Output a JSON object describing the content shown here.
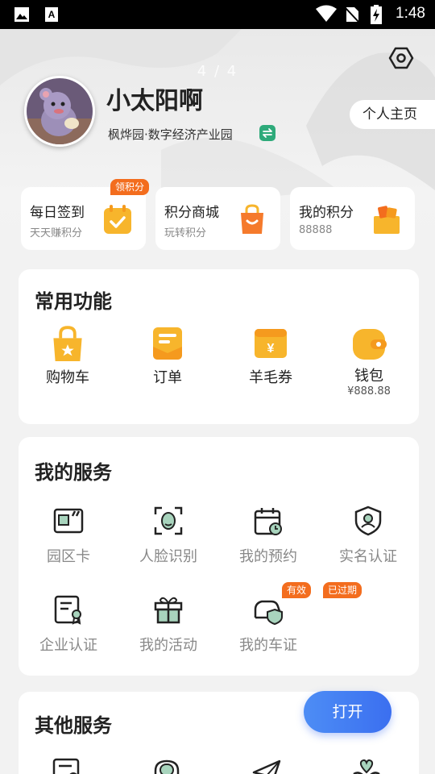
{
  "status_bar": {
    "time": "1:48",
    "left_icons": [
      "image-icon",
      "text-icon"
    ],
    "right_icons": [
      "wifi-icon",
      "no-sim-icon",
      "battery-charging-icon"
    ]
  },
  "header": {
    "page_indicator": "4 / 4",
    "username": "小太阳啊",
    "org": "枫烨园·数字经济产业园",
    "homepage_label": "个人主页"
  },
  "points_cards": [
    {
      "title": "每日签到",
      "subtitle": "天天赚积分",
      "badge": "领积分",
      "icon": "calendar-check-icon"
    },
    {
      "title": "积分商城",
      "subtitle": "玩转积分",
      "icon": "shopping-bag-icon"
    },
    {
      "title": "我的积分",
      "subtitle": "88888",
      "icon": "gift-box-icon"
    }
  ],
  "common_functions": {
    "title": "常用功能",
    "items": [
      {
        "label": "购物车",
        "icon": "shopping-bag-icon"
      },
      {
        "label": "订单",
        "icon": "order-list-icon"
      },
      {
        "label": "羊毛券",
        "icon": "coupon-icon"
      },
      {
        "label": "钱包",
        "value": "¥888.88",
        "icon": "wallet-icon"
      }
    ]
  },
  "my_services": {
    "title": "我的服务",
    "items": [
      {
        "label": "园区卡",
        "icon": "card-icon"
      },
      {
        "label": "人脸识别",
        "icon": "face-scan-icon"
      },
      {
        "label": "我的预约",
        "icon": "calendar-clock-icon"
      },
      {
        "label": "实名认证",
        "icon": "shield-user-icon"
      },
      {
        "label": "企业认证",
        "icon": "certificate-icon"
      },
      {
        "label": "我的活动",
        "icon": "gift-icon"
      },
      {
        "label": "我的车证",
        "icon": "car-shield-icon"
      }
    ],
    "badges": {
      "valid": "有效",
      "expired": "已过期"
    }
  },
  "other_services": {
    "title": "其他服务",
    "icons": [
      "document-icon",
      "headset-icon",
      "paper-plane-icon",
      "heart-hands-icon"
    ]
  },
  "open_button": "打开",
  "colors": {
    "accent_orange": "#f36d1e",
    "icon_yellow": "#f7b52c",
    "button_blue": "#3b6ff0",
    "green": "#2eaa7a"
  }
}
